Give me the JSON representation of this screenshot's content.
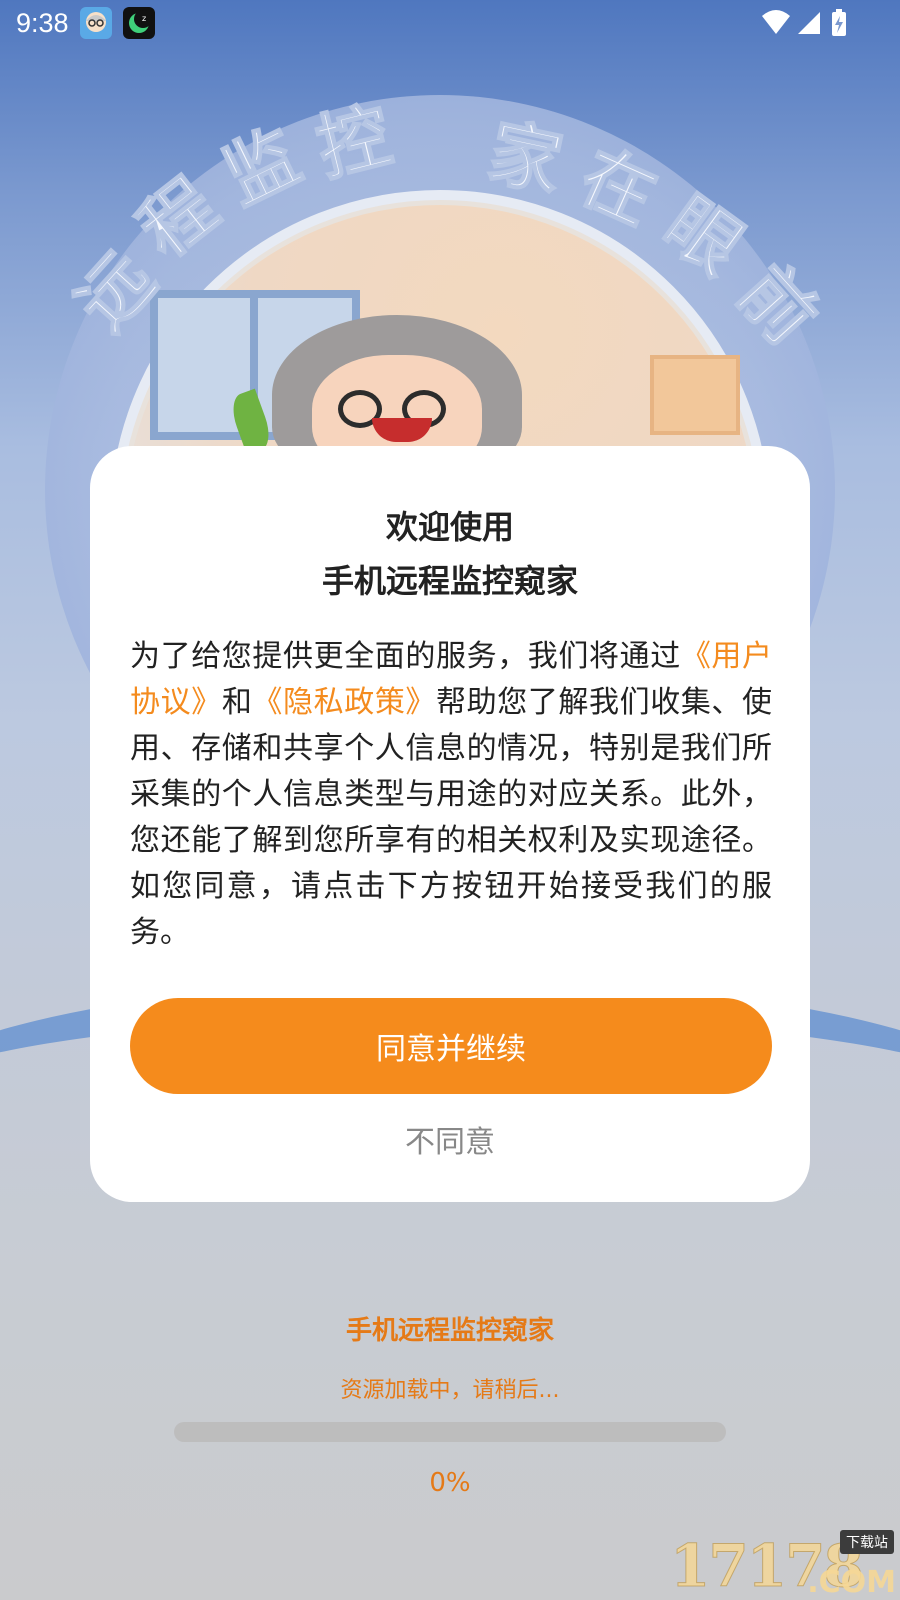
{
  "status_bar": {
    "time": "9:38",
    "app_icons": [
      "avatar-app-icon",
      "moon-app-icon"
    ],
    "right_icons": [
      "wifi-icon",
      "signal-icon",
      "battery-charging-icon"
    ]
  },
  "splash": {
    "slogan_left": "远程监控",
    "slogan_right": "家在眼前"
  },
  "dialog": {
    "title_line1": "欢迎使用",
    "title_line2": "手机远程监控窥家",
    "body_part1": "为了给您提供更全面的服务，我们将通过",
    "link_user_agreement": "《用户协议》",
    "body_part2": "和",
    "link_privacy_policy": "《隐私政策》",
    "body_part3": "帮助您了解我们收集、使用、存储和共享个人信息的情况，特别是我们所采集的个人信息类型与用途的对应关系。此外，您还能了解到您所享有的相关权利及实现途径。如您同意，请点击下方按钮开始接受我们的服务。",
    "agree_label": "同意并继续",
    "disagree_label": "不同意"
  },
  "loading": {
    "app_name": "手机远程监控窥家",
    "message": "资源加载中，请稍后...",
    "progress_percent": 0,
    "progress_text": "0%"
  },
  "watermark": {
    "number": "17178",
    "tag": "下载站",
    "suffix": ".COM"
  },
  "colors": {
    "accent": "#f58b1c",
    "link": "#f48b1e",
    "loading_text": "#e57a17",
    "dialog_bg": "#ffffff"
  }
}
